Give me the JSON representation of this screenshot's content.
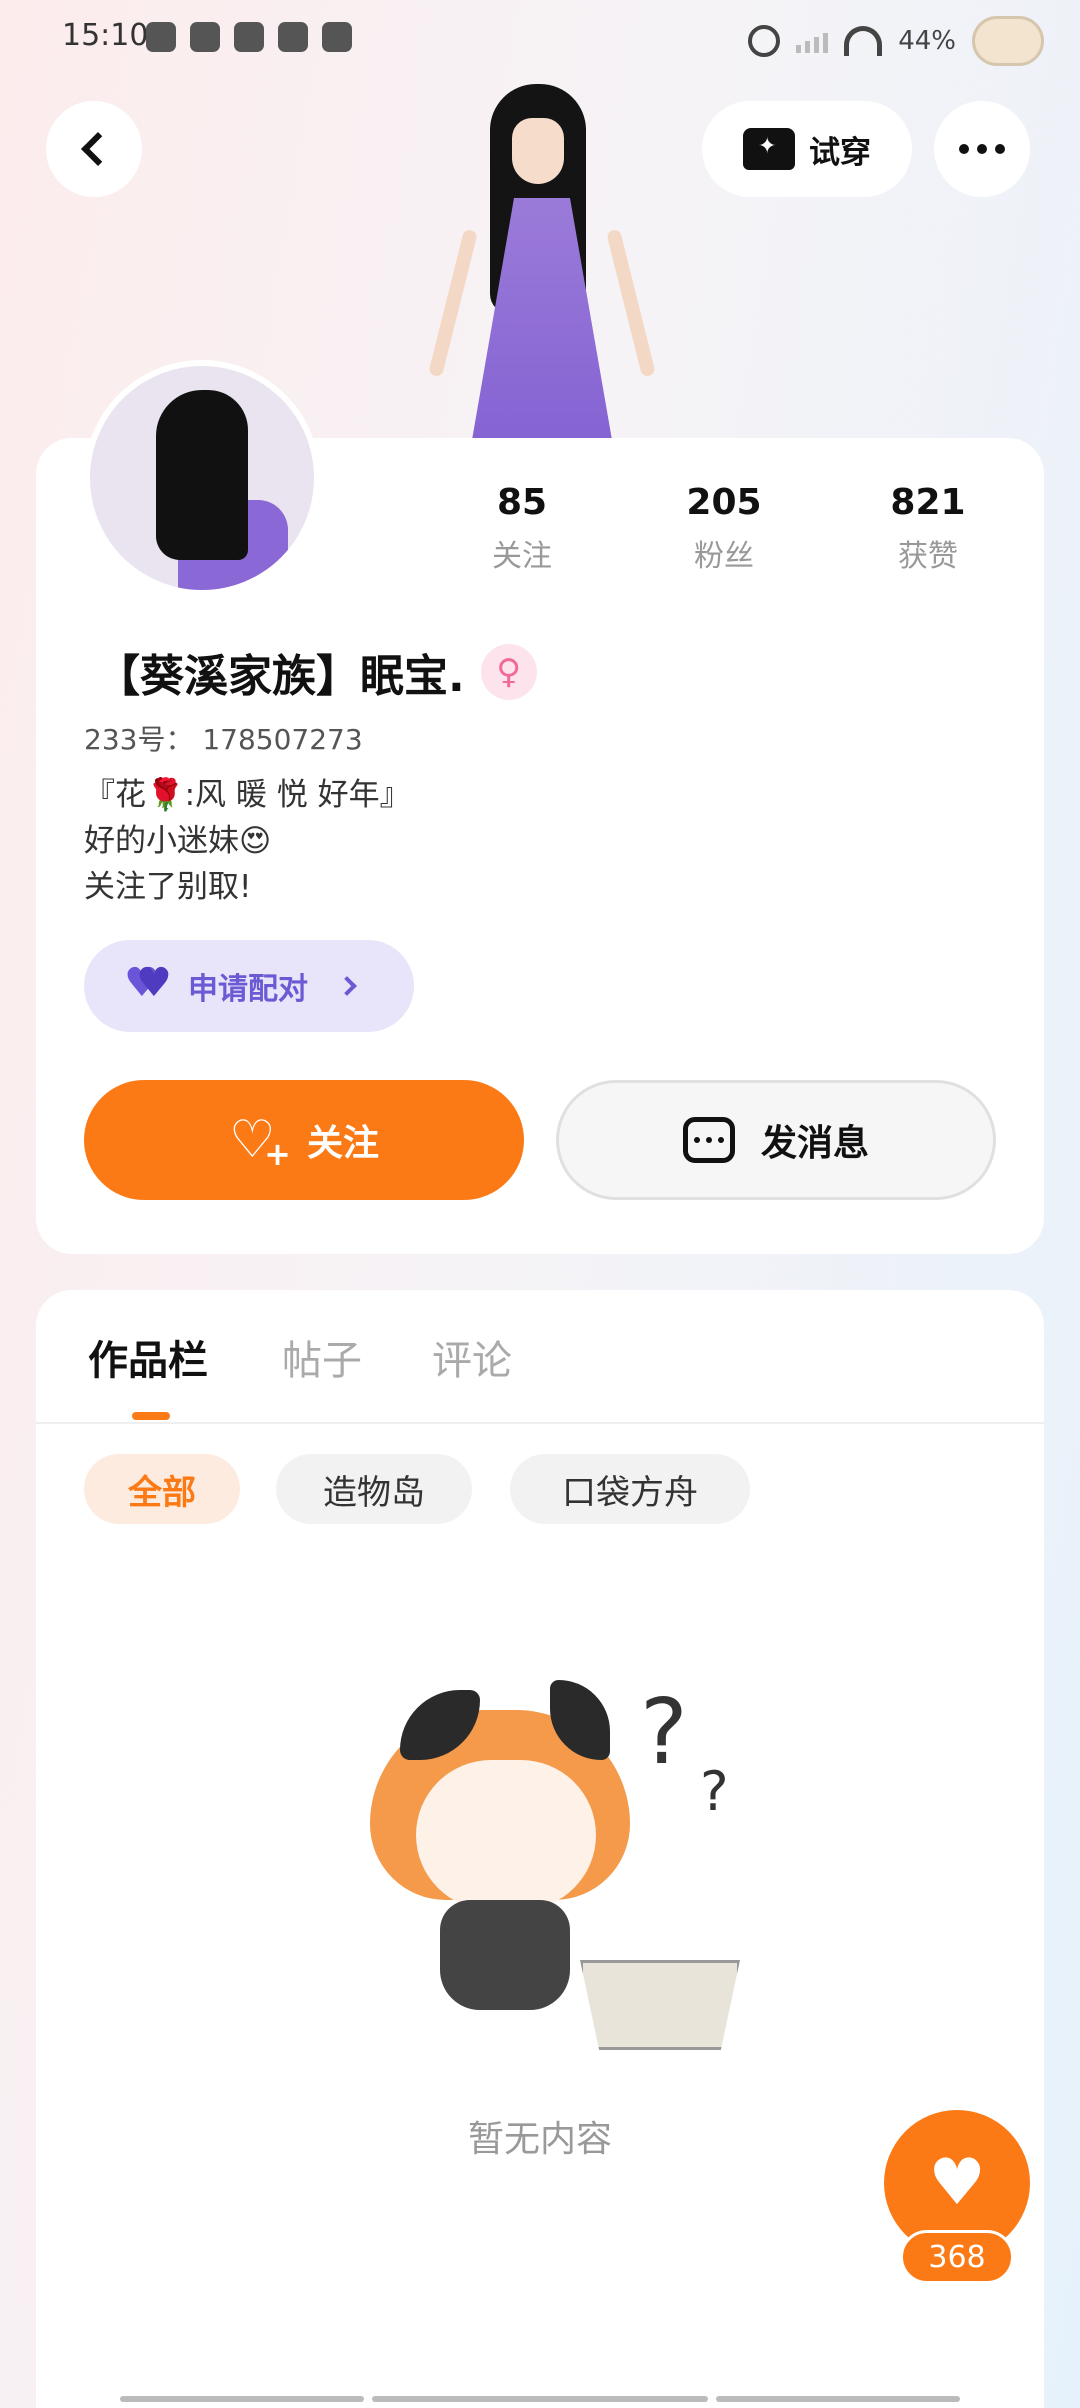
{
  "status_bar": {
    "time": "15:10",
    "battery": "44%"
  },
  "nav": {
    "try_on_label": "试穿"
  },
  "profile": {
    "stats": [
      {
        "value": "85",
        "label": "关注"
      },
      {
        "value": "205",
        "label": "粉丝"
      },
      {
        "value": "821",
        "label": "获赞"
      }
    ],
    "nickname": "【葵溪家族】眠宝.",
    "gender_symbol": "♀",
    "uid": "233号： 178507273",
    "bio": [
      "『花🌹:风 暖 悦 好年』",
      "好的小迷妹😍",
      "关注了别取!"
    ],
    "pair_button_label": "申请配对",
    "follow_label": "关注",
    "message_label": "发消息"
  },
  "works": {
    "tabs": [
      {
        "label": "作品栏",
        "active": true
      },
      {
        "label": "帖子",
        "active": false
      },
      {
        "label": "评论",
        "active": false
      }
    ],
    "filters": [
      {
        "label": "全部",
        "active": true
      },
      {
        "label": "造物岛",
        "active": false
      },
      {
        "label": "口袋方舟",
        "active": false
      }
    ],
    "empty_text": "暂无内容"
  },
  "like_fab": {
    "count": "368"
  },
  "colors": {
    "accent": "#fb7a15",
    "pair_purple": "#6a5bd4"
  }
}
